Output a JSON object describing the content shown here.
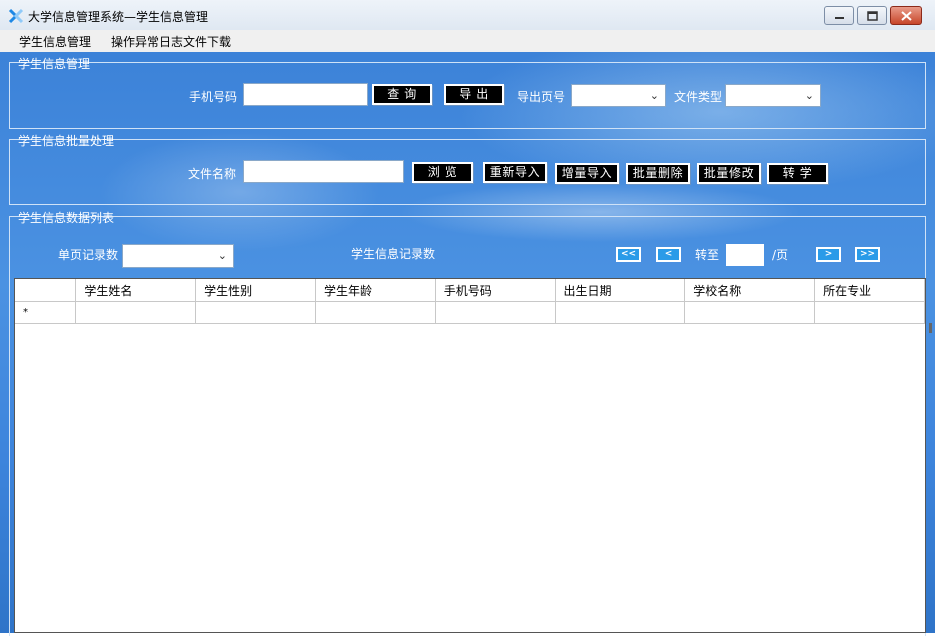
{
  "window": {
    "title": "大学信息管理系统—学生信息管理"
  },
  "menu": {
    "items": [
      "学生信息管理",
      "操作异常日志文件下载"
    ]
  },
  "query_group": {
    "legend": "学生信息管理",
    "phone_label": "手机号码",
    "phone_value": "",
    "query_button": "查 询",
    "export_button": "导 出",
    "export_page_label": "导出页号",
    "export_page_value": "",
    "file_type_label": "文件类型",
    "file_type_value": ""
  },
  "batch_group": {
    "legend": "学生信息批量处理",
    "file_name_label": "文件名称",
    "file_name_value": "",
    "browse_button": "浏 览",
    "reimport_button": "重新导入",
    "incremental_import_button": "增量导入",
    "batch_delete_button": "批量删除",
    "batch_modify_button": "批量修改",
    "transfer_button": "转 学"
  },
  "list_group": {
    "legend": "学生信息数据列表",
    "page_size_label": "单页记录数",
    "page_size_value": "",
    "record_count_label": "学生信息记录数",
    "first_button": "<<",
    "prev_button": "<",
    "goto_label": "转至",
    "goto_value": "",
    "page_suffix": "/页",
    "next_button": ">",
    "last_button": ">>"
  },
  "table": {
    "columns": [
      "学生姓名",
      "学生性别",
      "学生年龄",
      "手机号码",
      "出生日期",
      "学校名称",
      "所在专业"
    ],
    "new_row_marker": "*"
  },
  "colors": {
    "background_blue": "#3c82d8",
    "button_black": "#000000",
    "nav_button_blue": "#2a9be8"
  }
}
